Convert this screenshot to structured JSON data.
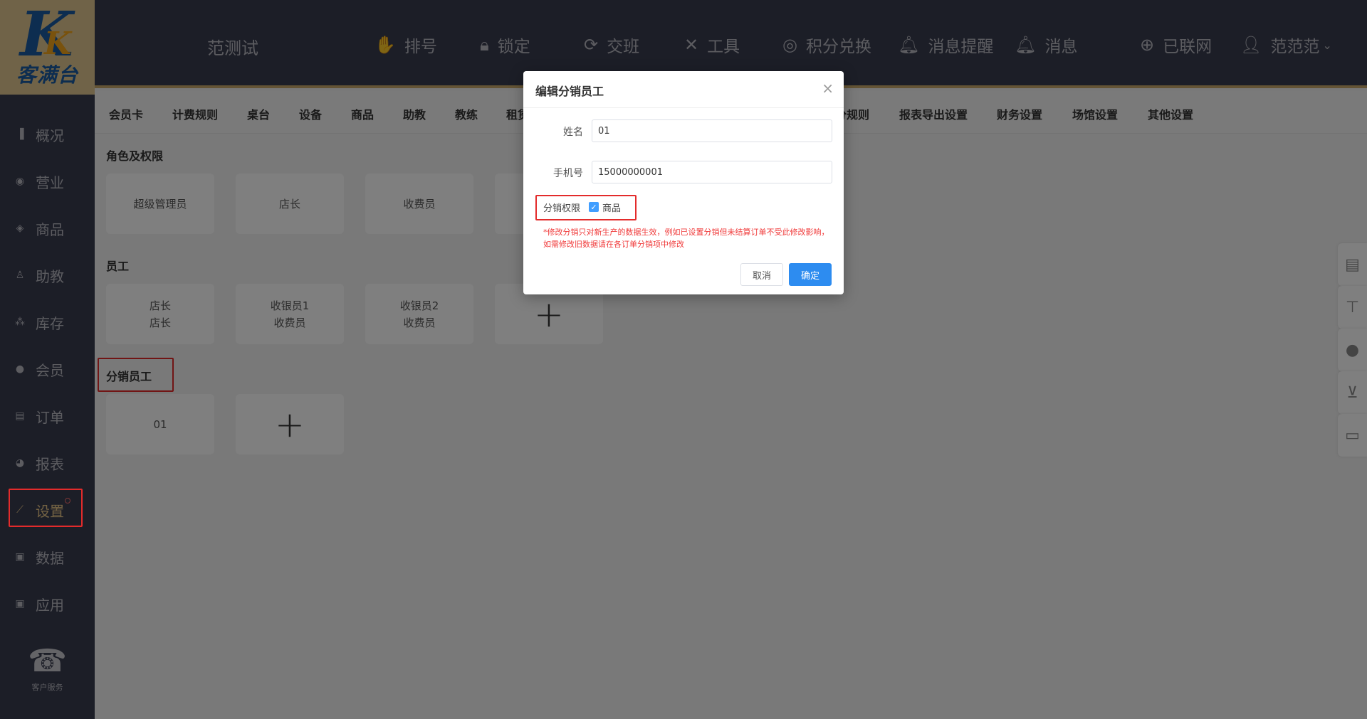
{
  "brand": {
    "logo_letter": "K",
    "name": "客满台"
  },
  "header": {
    "store_name": "范测试",
    "nav": [
      {
        "label": "排号",
        "icon": "queue-icon"
      },
      {
        "label": "锁定",
        "icon": "lock-icon"
      },
      {
        "label": "交班",
        "icon": "refresh-icon"
      },
      {
        "label": "工具",
        "icon": "tools-icon"
      },
      {
        "label": "积分兑换",
        "icon": "coins-icon"
      },
      {
        "label": "消息提醒",
        "icon": "bell-icon"
      },
      {
        "label": "消息",
        "icon": "bell-icon"
      },
      {
        "label": "已联网",
        "icon": "globe-icon"
      },
      {
        "label": "范范范",
        "icon": "user-icon"
      }
    ]
  },
  "sidebar": {
    "items": [
      {
        "label": "概况",
        "icon": "bar-chart-icon"
      },
      {
        "label": "营业",
        "icon": "circle-icon"
      },
      {
        "label": "商品",
        "icon": "box-icon"
      },
      {
        "label": "助教",
        "icon": "person-icon"
      },
      {
        "label": "库存",
        "icon": "stack-icon"
      },
      {
        "label": "会员",
        "icon": "vip-icon"
      },
      {
        "label": "订单",
        "icon": "list-icon"
      },
      {
        "label": "报表",
        "icon": "pie-icon"
      },
      {
        "label": "设置",
        "icon": "wrench-icon"
      },
      {
        "label": "数据",
        "icon": "data-icon"
      },
      {
        "label": "应用",
        "icon": "app-icon"
      }
    ],
    "service_label": "客户服务"
  },
  "subtabs": [
    "会员卡",
    "计费规则",
    "桌台",
    "设备",
    "商品",
    "助教",
    "教练",
    "租赁",
    "分规则",
    "报表导出设置",
    "财务设置",
    "场馆设置",
    "其他设置"
  ],
  "sections": {
    "roles": {
      "title": "角色及权限",
      "cards": [
        "超级管理员",
        "店长",
        "收费员",
        ""
      ]
    },
    "staff": {
      "title": "员工",
      "cards": [
        {
          "name": "店长",
          "role": "店长"
        },
        {
          "name": "收银员1",
          "role": "收费员"
        },
        {
          "name": "收银员2",
          "role": "收费员"
        }
      ]
    },
    "distributors": {
      "title": "分销员工",
      "cards": [
        "01"
      ]
    }
  },
  "modal": {
    "title": "编辑分销员工",
    "name_label": "姓名",
    "name_value": "01",
    "phone_label": "手机号",
    "phone_value": "15000000001",
    "perm_label": "分销权限",
    "perm_option": "商品",
    "warning": "*修改分销只对新生产的数据生效，例如已设置分销但未结算订单不受此修改影响，如需修改旧数据请在各订单分销项中修改",
    "cancel_label": "取消",
    "ok_label": "确定"
  },
  "colors": {
    "sidebar_bg": "#393c4f",
    "accent_gold": "#c9a86a",
    "primary_blue": "#2d8cf0",
    "highlight_red": "#e32b2b"
  }
}
